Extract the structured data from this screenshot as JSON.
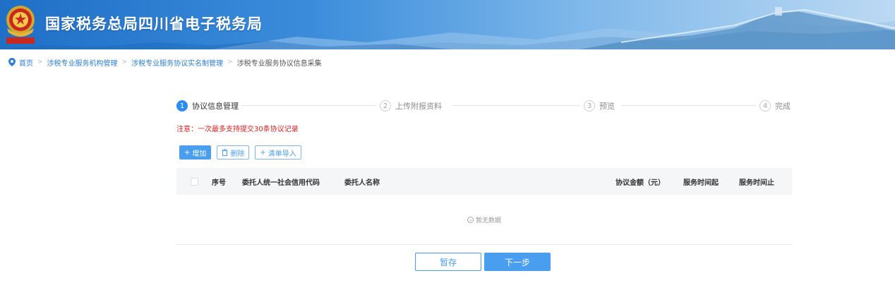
{
  "header": {
    "site_title": "国家税务总局四川省电子税务局",
    "emblem_icon": "tax-emblem-icon"
  },
  "breadcrumb": {
    "home": "首页",
    "items": [
      "涉税专业服务机构管理",
      "涉税专业服务协议实名制管理"
    ],
    "current": "涉税专业服务协议信息采集",
    "separator": ">"
  },
  "steps": [
    {
      "number": "1",
      "label": "协议信息管理",
      "active": true
    },
    {
      "number": "2",
      "label": "上传附报资料",
      "active": false
    },
    {
      "number": "3",
      "label": "预览",
      "active": false
    },
    {
      "number": "4",
      "label": "完成",
      "active": false
    }
  ],
  "notice": "注意：一次最多支持提交30条协议记录",
  "toolbar": {
    "add": "增加",
    "delete": "删除",
    "import": "清单导入"
  },
  "table": {
    "columns": [
      "序号",
      "委托人统一社会信用代码",
      "委托人名称",
      "协议金额（元）",
      "服务时间起",
      "服务时间止"
    ],
    "empty_text": "暂无数据"
  },
  "footer": {
    "save": "暂存",
    "next": "下一步"
  },
  "colors": {
    "primary": "#2d8cf0",
    "button": "#4a9ef0",
    "notice": "#e02020",
    "header_start": "#1f6fc7"
  }
}
